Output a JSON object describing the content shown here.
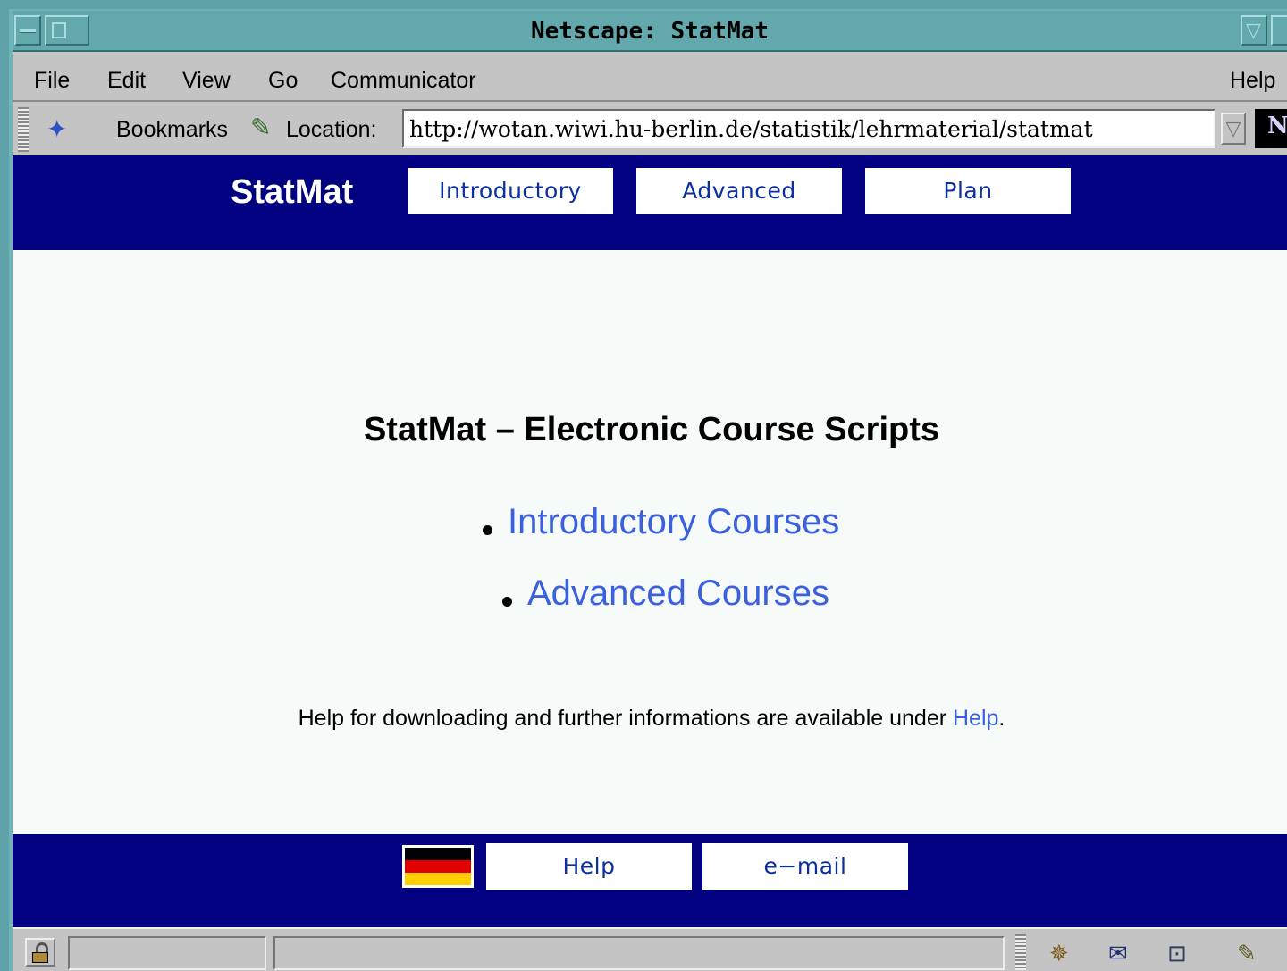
{
  "window": {
    "title": "Netscape: StatMat"
  },
  "menu": {
    "items": [
      "File",
      "Edit",
      "View",
      "Go",
      "Communicator"
    ],
    "help": "Help"
  },
  "location": {
    "bookmarks_label": "Bookmarks",
    "location_label": "Location:",
    "url": "http://wotan.wiwi.hu-berlin.de/statistik/lehrmaterial/statmat"
  },
  "page": {
    "brand": "StatMat",
    "nav": [
      "Introductory",
      "Advanced",
      "Plan"
    ],
    "heading": "StatMat – Electronic Course Scripts",
    "links": [
      "Introductory Courses",
      "Advanced Courses"
    ],
    "help_text": "Help for downloading and further informations are available under ",
    "help_link": "Help",
    "help_end": ".",
    "footer": [
      "Help",
      "e−mail"
    ]
  },
  "colors": {
    "nav_bg": "#000080",
    "link": "#3a60e0",
    "page_bg": "#f6fbf9"
  }
}
